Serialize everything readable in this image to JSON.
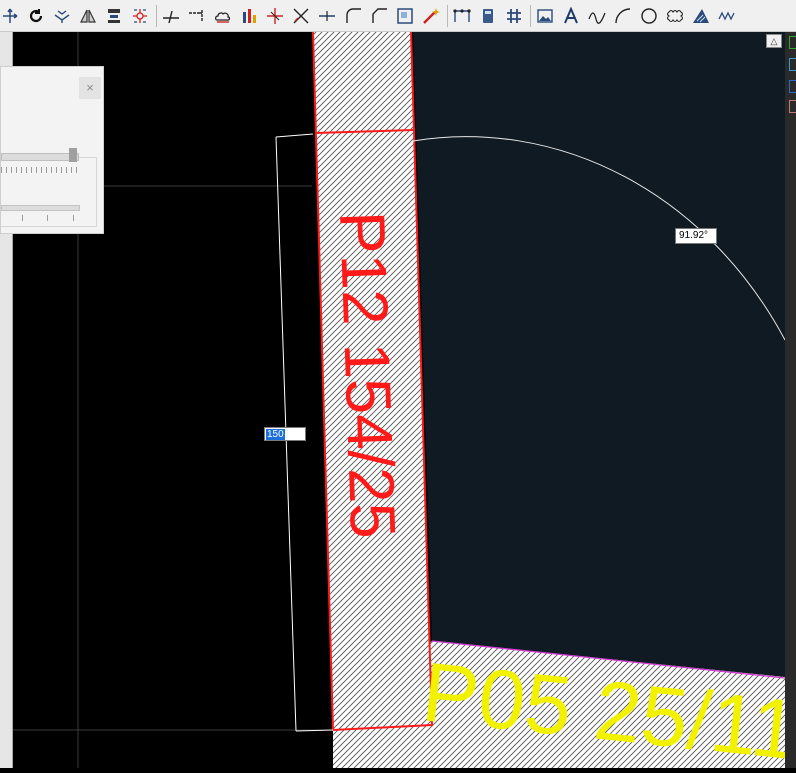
{
  "toolbar": {
    "tools": [
      "move-icon",
      "rotate-icon",
      "offset-icon",
      "mirror-icon",
      "align-icon",
      "array-icon",
      "trim-icon",
      "extend-icon",
      "cloud-icon",
      "dimension-icon",
      "cross-icon",
      "x-icon",
      "split-icon",
      "fillet-icon",
      "chamfer-icon",
      "region-icon",
      "magic-wand-icon",
      "polyline-edit-icon",
      "block-icon",
      "grid-icon",
      "image-icon",
      "text-icon",
      "spline-icon",
      "arc-icon",
      "circle-icon",
      "revision-cloud-icon",
      "hatch-icon",
      "wave-icon"
    ]
  },
  "drawing": {
    "label_p12": "P12 154/25",
    "label_p05": "P05 25/11",
    "dimension_value": "150",
    "angle_value": "91.92°",
    "colors": {
      "background": "#000000",
      "inner_area": "#0f1a22",
      "p12_color": "#ff1a1a",
      "p05_color": "#f2f200",
      "p05_outline": "#d23ad2",
      "construction": "#ffffff"
    }
  },
  "viewport": {
    "maximize_label": "△"
  },
  "panel": {
    "close_label": "×"
  }
}
